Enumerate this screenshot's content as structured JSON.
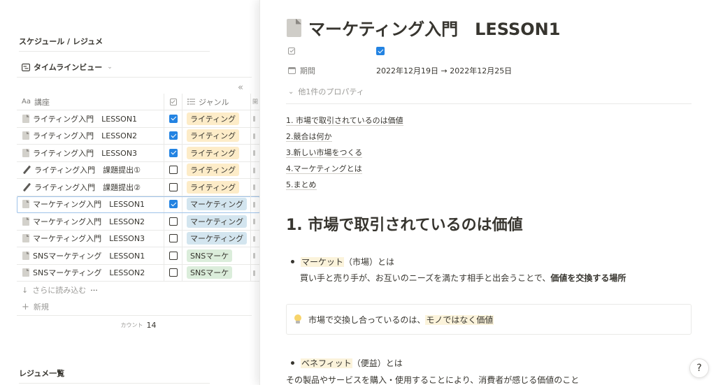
{
  "left": {
    "section_title": "スケジュール / レジュメ",
    "view_label": "タイムラインビュー",
    "collapse_glyph": "«",
    "columns": {
      "name": "講座",
      "name_prefix": "Aa",
      "genre": "ジャンル",
      "extra": "開"
    },
    "rows": [
      {
        "icon": "doc",
        "name": "ライティング入門　LESSON1",
        "checked": true,
        "genre": "ライティング",
        "genre_color": "#fdecc8"
      },
      {
        "icon": "doc",
        "name": "ライティング入門　LESSON2",
        "checked": true,
        "genre": "ライティング",
        "genre_color": "#fdecc8"
      },
      {
        "icon": "doc",
        "name": "ライティング入門　LESSON3",
        "checked": true,
        "genre": "ライティング",
        "genre_color": "#fdecc8"
      },
      {
        "icon": "pen",
        "name": "ライティング入門　課題提出①",
        "checked": false,
        "genre": "ライティング",
        "genre_color": "#fdecc8"
      },
      {
        "icon": "pen",
        "name": "ライティング入門　課題提出②",
        "checked": false,
        "genre": "ライティング",
        "genre_color": "#fdecc8"
      },
      {
        "icon": "doc",
        "name": "マーケティング入門　LESSON1",
        "checked": true,
        "genre": "マーケティング",
        "genre_color": "#d3e5ef",
        "selected": true
      },
      {
        "icon": "doc",
        "name": "マーケティング入門　LESSON2",
        "checked": false,
        "genre": "マーケティング",
        "genre_color": "#d3e5ef"
      },
      {
        "icon": "doc",
        "name": "マーケティング入門　LESSON3",
        "checked": false,
        "genre": "マーケティング",
        "genre_color": "#d3e5ef"
      },
      {
        "icon": "doc",
        "name": "SNSマーケティング　LESSON1",
        "checked": false,
        "genre": "SNSマーケ",
        "genre_color": "#dbeddb"
      },
      {
        "icon": "doc",
        "name": "SNSマーケティング　LESSON2",
        "checked": false,
        "genre": "SNSマーケ",
        "genre_color": "#dbeddb"
      }
    ],
    "load_more": "さらに読み込む",
    "load_more_dots": "···",
    "new_label": "新規",
    "count_label": "カウント",
    "count_value": "14",
    "section2_title": "レジュメ一覧"
  },
  "page": {
    "title": "マーケティング入門　LESSON1",
    "prop_checked": true,
    "period_label": "期間",
    "period_value": "2022年12月19日 → 2022年12月25日",
    "more_props": "他1件のプロパティ",
    "toc": [
      "1. 市場で取引されているのは価値",
      "2.競合は何か",
      "3.新しい市場をつくる",
      "4.マーケティングとは",
      "5.まとめ"
    ],
    "heading1": "1. 市場で取引されているのは価値",
    "bullet1_hl": "マーケット",
    "bullet1_rest": "（市場）とは",
    "para1_a": "買い手と売り手が、お互いのニーズを満たす相手と出会うことで、",
    "para1_b": "価値を交換する場所",
    "callout_a": "市場で交換し合っているのは、",
    "callout_b": "モノではなく価値",
    "bullet2_hl": "ベネフィット",
    "bullet2_rest": "（便益）とは",
    "para2": "その製品やサービスを購入・使用することにより、消費者が感じる価値のこと"
  },
  "help_label": "?"
}
